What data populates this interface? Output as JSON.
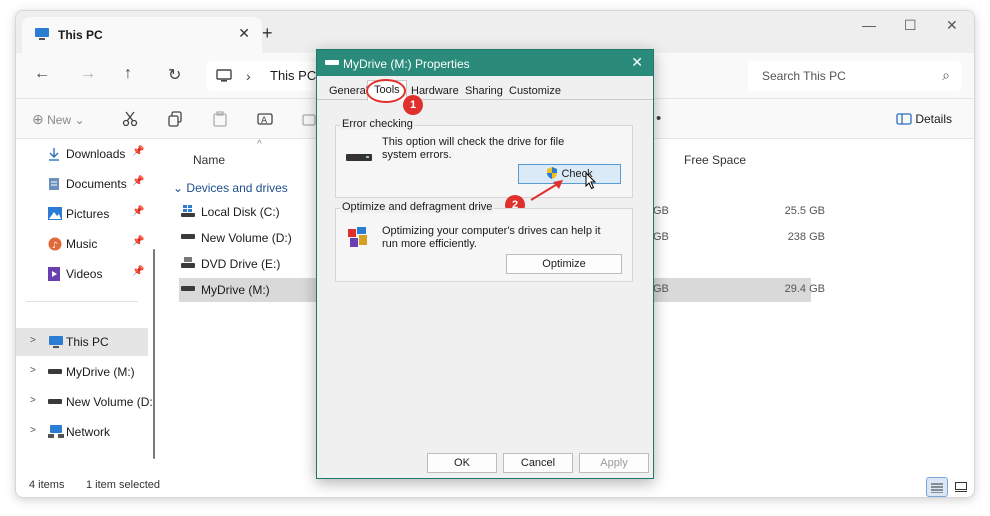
{
  "window": {
    "tab_title": "This PC",
    "tab_close": "✕",
    "new_tab": "+",
    "minimize": "—",
    "maximize": "☐",
    "close": "✕"
  },
  "address": {
    "back": "←",
    "forward": "→",
    "up": "↑",
    "refresh": "↻",
    "chevron": "›",
    "path": "This PC",
    "search_placeholder": "Search This PC",
    "search_glyph": "⌕"
  },
  "toolbar": {
    "new_label": "New",
    "new_glyph": "⊕",
    "new_chevron": "⌄",
    "details_label": "Details",
    "more_glyph": "•"
  },
  "sidebar": {
    "quick_access": [
      {
        "label": "Downloads",
        "icon": "download-icon"
      },
      {
        "label": "Documents",
        "icon": "documents-icon"
      },
      {
        "label": "Pictures",
        "icon": "pictures-icon"
      },
      {
        "label": "Music",
        "icon": "music-icon"
      },
      {
        "label": "Videos",
        "icon": "videos-icon"
      }
    ],
    "pin_glyph": "📌",
    "expand_glyph": ">",
    "tree": [
      {
        "label": "This PC",
        "selected": true
      },
      {
        "label": "MyDrive (M:)"
      },
      {
        "label": "New Volume (D:"
      },
      {
        "label": "Network"
      }
    ]
  },
  "content": {
    "col_name": "Name",
    "col_free": "Free Space",
    "sort_glyph": "^",
    "group_label": "Devices and drives",
    "group_glyph": "⌄",
    "drives": [
      {
        "name": "Local Disk (C:)",
        "total": "GB",
        "free": "25.5 GB"
      },
      {
        "name": "New Volume (D:)",
        "total": "GB",
        "free": "238 GB"
      },
      {
        "name": "DVD Drive (E:)",
        "total": "",
        "free": ""
      },
      {
        "name": "MyDrive (M:)",
        "total": "GB",
        "free": "29.4 GB",
        "selected": true
      }
    ]
  },
  "status": {
    "items": "4 items",
    "selected": "1 item selected"
  },
  "dialog": {
    "title": "MyDrive (M:) Properties",
    "close": "✕",
    "tabs": [
      "General",
      "Tools",
      "Hardware",
      "Sharing",
      "Customize"
    ],
    "active_tab": "Tools",
    "error_checking": {
      "legend": "Error checking",
      "text": "This option will check the drive for file system errors.",
      "button": "Check"
    },
    "optimize": {
      "legend": "Optimize and defragment drive",
      "text": "Optimizing your computer's drives can help it run more efficiently.",
      "button": "Optimize"
    },
    "ok": "OK",
    "cancel": "Cancel",
    "apply": "Apply"
  },
  "annotations": {
    "step1": "1",
    "step2": "2",
    "color": "#e0302c"
  },
  "colors": {
    "dialog_title": "#2a8b7a",
    "selection": "#d9d9d9",
    "link": "#1f4e8c"
  }
}
